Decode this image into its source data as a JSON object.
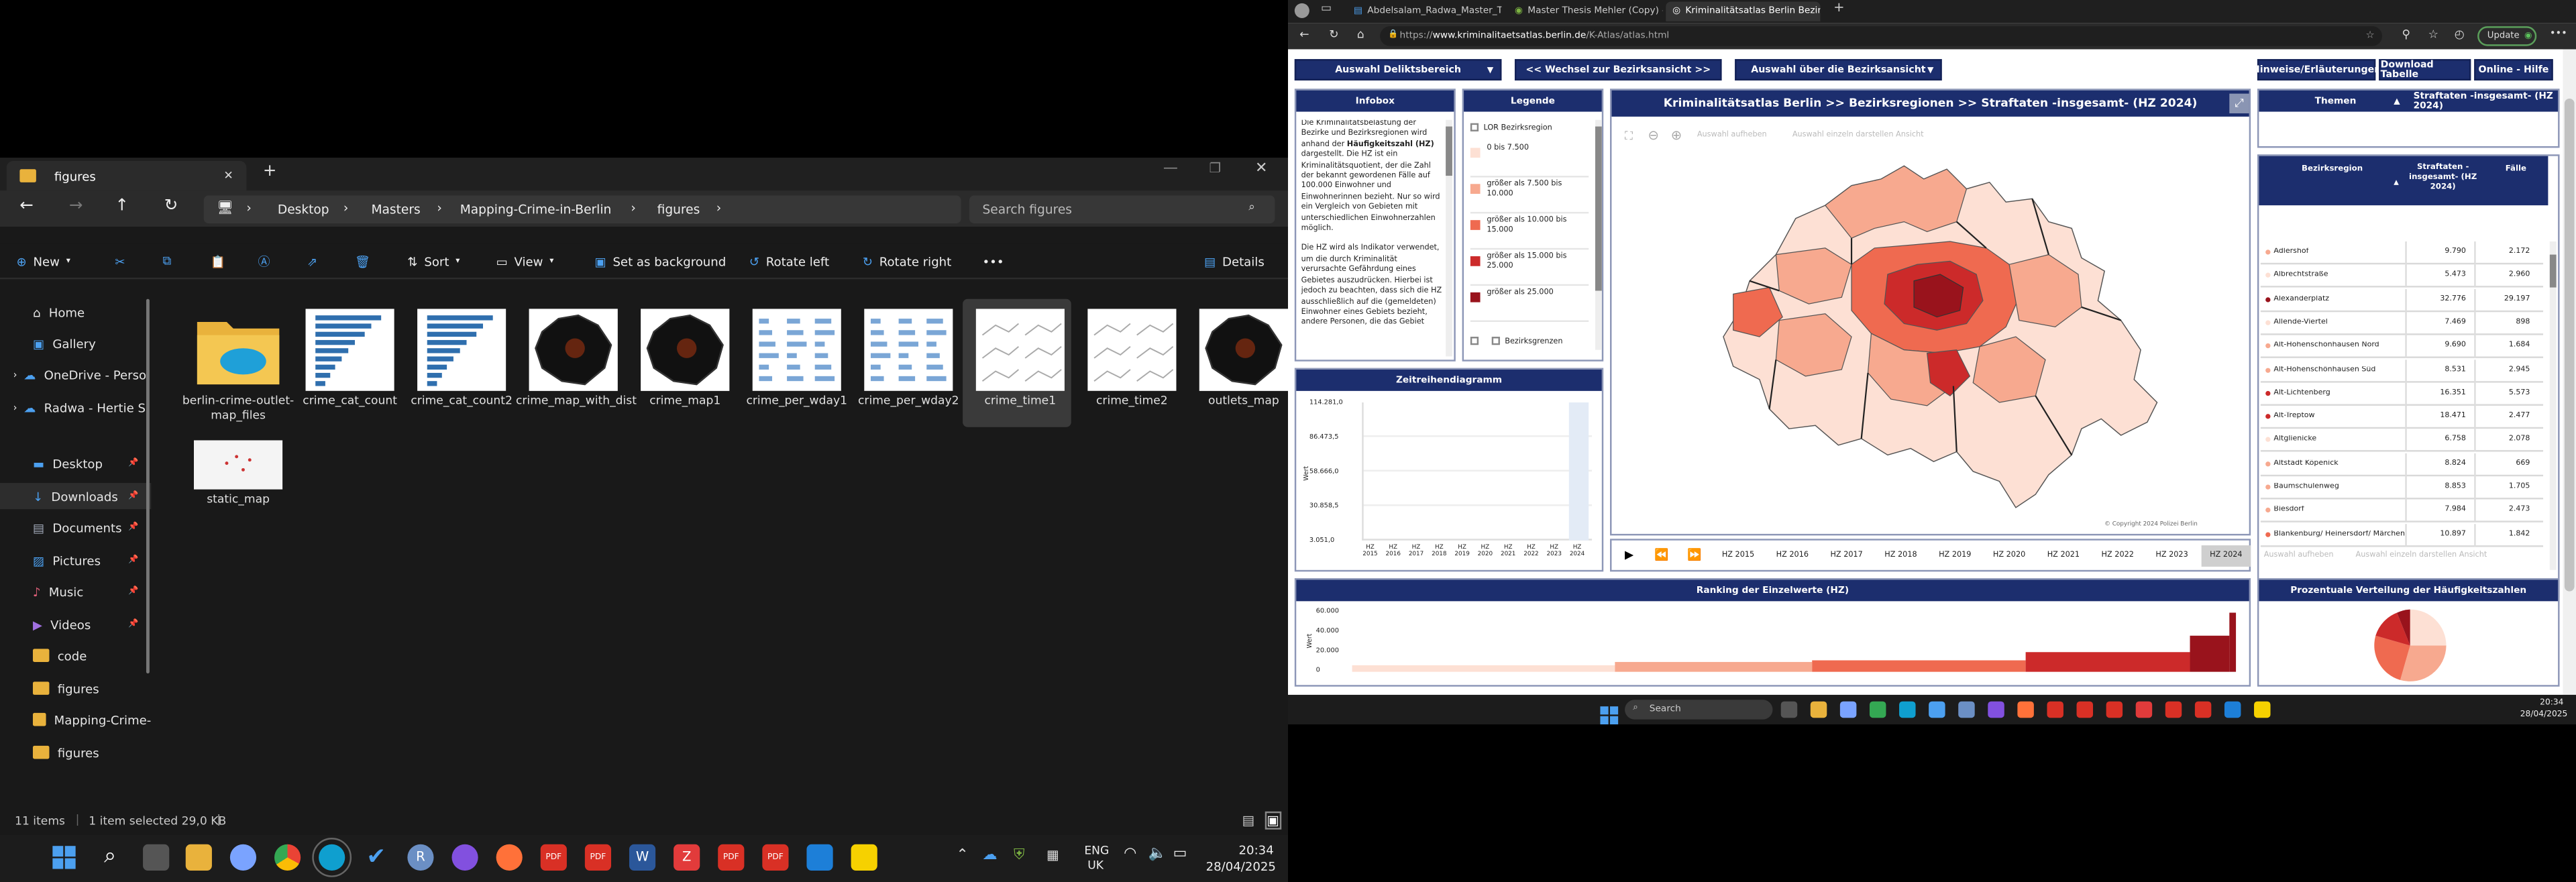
{
  "explorer": {
    "tab_title": "figures",
    "nav": {
      "breadcrumb": [
        "Desktop",
        "Masters",
        "Mapping-Crime-in-Berlin",
        "figures"
      ],
      "search_placeholder": "Search figures"
    },
    "toolbar": {
      "new": "New",
      "sort": "Sort",
      "view": "View",
      "set_background": "Set as background",
      "rotate_left": "Rotate left",
      "rotate_right": "Rotate right",
      "details": "Details"
    },
    "sidebar": [
      "Home",
      "Gallery",
      "OneDrive - Perso",
      "Radwa - Hertie S",
      "Desktop",
      "Downloads",
      "Documents",
      "Pictures",
      "Music",
      "Videos",
      "code",
      "figures",
      "Mapping-Crime-",
      "figures"
    ],
    "files": [
      {
        "name": "berlin-crime-outlet-map_files",
        "kind": "folder"
      },
      {
        "name": "crime_cat_count",
        "kind": "bars"
      },
      {
        "name": "crime_cat_count2",
        "kind": "bars"
      },
      {
        "name": "crime_map_with_dist",
        "kind": "map"
      },
      {
        "name": "crime_map1",
        "kind": "map"
      },
      {
        "name": "crime_per_wday1",
        "kind": "bars2"
      },
      {
        "name": "crime_per_wday2",
        "kind": "bars2"
      },
      {
        "name": "crime_time1",
        "kind": "lines",
        "selected": true
      },
      {
        "name": "crime_time2",
        "kind": "lines"
      },
      {
        "name": "outlets_map",
        "kind": "map"
      },
      {
        "name": "static_map",
        "kind": "static"
      }
    ],
    "status": {
      "items": "11 items",
      "selected": "1 item selected  29,0 KB"
    }
  },
  "taskbar": {
    "lang": "ENG",
    "region": "UK",
    "time": "20:34",
    "date": "28/04/2025"
  },
  "browser": {
    "tabs": [
      "Abdelsalam_Radwa_Master_Thesi",
      "Master Thesis Mehler (Copy) - Cr",
      "Kriminalitätsatlas Berlin Bezirksr"
    ],
    "url_prefix": "https://",
    "url_domain": "www.kriminalitaetsatlas.berlin.de",
    "url_path": "/K-Atlas/atlas.html",
    "update_label": "Update",
    "nav": {
      "deliktsbereich": "Auswahl Deliktsbereich",
      "wechsel": "<< Wechsel zur Bezirksansicht >>",
      "auswahl_bezirk": "Auswahl über die Bezirksansicht",
      "hinweise": "Hinweise/Erläuterungen",
      "download": "Download Tabelle",
      "hilfe": "Online - Hilfe"
    },
    "infobox": {
      "title": "Infobox",
      "text1a": "Die Kriminalitätsbelastung der Bezirke und Bezirksregionen wird anhand der ",
      "text1b": "Häufigkeitszahl (HZ)",
      "text1c": " dargestellt. Die HZ ist ein Kriminalitätsquotient, der die Zahl der bekannt gewordenen Fälle auf 100.000 Einwohner und Einwohnerinnen bezieht. Nur so wird ein Vergleich von Gebieten mit unterschiedlichen Einwohnerzahlen möglich.",
      "text2": "Die HZ wird als Indikator verwendet, um die durch Kriminalität verursachte Gefährdung eines Gebietes auszudrücken. Hierbei ist jedoch zu beachten, dass sich die HZ ausschließlich auf die (gemeldeten) Einwohner eines Gebiets bezieht, andere Personen, die das Gebiet"
    },
    "legende": {
      "title": "Legende",
      "layer": "LOR Bezirksregion",
      "classes": [
        {
          "label": "0 bis 7.500",
          "color": "#fde0d4"
        },
        {
          "label": "größer als 7.500 bis 10.000",
          "color": "#f7a98f"
        },
        {
          "label": "größer als 10.000 bis 15.000",
          "color": "#ef6a50"
        },
        {
          "label": "größer als 15.000 bis 25.000",
          "color": "#cc2a2a"
        },
        {
          "label": "größer als 25.000",
          "color": "#99131c"
        }
      ],
      "bezirksgrenzen": "Bezirksgrenzen"
    },
    "map": {
      "title": "Kriminalitätsatlas Berlin >> Bezirksregionen >>  Straftaten -insgesamt- (HZ 2024)",
      "tool1": "Auswahl aufheben",
      "tool2": "Auswahl einzeln darstellen Ansicht",
      "copyright": "© Copyright 2024 Polizei Berlin",
      "years": [
        "HZ 2015",
        "HZ 2016",
        "HZ 2017",
        "HZ 2018",
        "HZ 2019",
        "HZ 2020",
        "HZ 2021",
        "HZ 2022",
        "HZ 2023",
        "HZ 2024"
      ],
      "active_year": "HZ 2024"
    },
    "zeitreihe": {
      "title": "Zeitreihendiagramm",
      "ylabel": "Wert",
      "yticks": [
        "114.281,0",
        "86.473,5",
        "58.666,0",
        "30.858,5",
        "3.051,0"
      ],
      "xticks": [
        "HZ 2015",
        "HZ 2016",
        "HZ 2017",
        "HZ 2018",
        "HZ 2019",
        "HZ 2020",
        "HZ 2021",
        "HZ 2022",
        "HZ 2023",
        "HZ 2024"
      ]
    },
    "table": {
      "themen_label": "Themen",
      "themen_value": "Straftaten -insgesamt- (HZ 2024)",
      "col1": "Bezirksregion",
      "col2": "Straftaten -insgesamt- (HZ 2024)",
      "col3": "Fälle",
      "rows": [
        [
          "Adlershof",
          "9.790",
          "2.172",
          "#f7a98f"
        ],
        [
          "Albrechtstraße",
          "5.473",
          "2.960",
          "#fde0d4"
        ],
        [
          "Alexanderplatz",
          "32.776",
          "29.197",
          "#99131c"
        ],
        [
          "Allende-Viertel",
          "7.469",
          "898",
          "#fde0d4"
        ],
        [
          "Alt-Hohenschönhausen Nord",
          "9.690",
          "1.684",
          "#f7a98f"
        ],
        [
          "Alt-Hohenschönhausen Süd",
          "8.531",
          "2.945",
          "#f7a98f"
        ],
        [
          "Alt-Lichtenberg",
          "16.351",
          "5.573",
          "#cc2a2a"
        ],
        [
          "Alt-Treptow",
          "18.471",
          "2.477",
          "#cc2a2a"
        ],
        [
          "Altglienicke",
          "6.758",
          "2.078",
          "#fde0d4"
        ],
        [
          "Altstadt Köpenick",
          "8.824",
          "669",
          "#f7a98f"
        ],
        [
          "Baumschulenweg",
          "8.853",
          "1.705",
          "#f7a98f"
        ],
        [
          "Biesdorf",
          "7.984",
          "2.473",
          "#f7a98f"
        ],
        [
          "Blankenburg/ Heinersdorf/ Märchenland",
          "10.897",
          "1.842",
          "#ef6a50"
        ]
      ],
      "footer1": "Auswahl aufheben",
      "footer2": "Auswahl einzeln darstellen Ansicht"
    },
    "ranking": {
      "title": "Ranking der Einzelwerte (HZ)",
      "ylabel": "Wert",
      "yticks": [
        "60.000",
        "40.000",
        "20.000",
        "0"
      ]
    },
    "verteilung": {
      "title": "Prozentuale Verteilung der Häufigkeitszahlen"
    }
  },
  "taskbar2": {
    "search": "Search",
    "time": "20:34",
    "date": "28/04/2025"
  }
}
